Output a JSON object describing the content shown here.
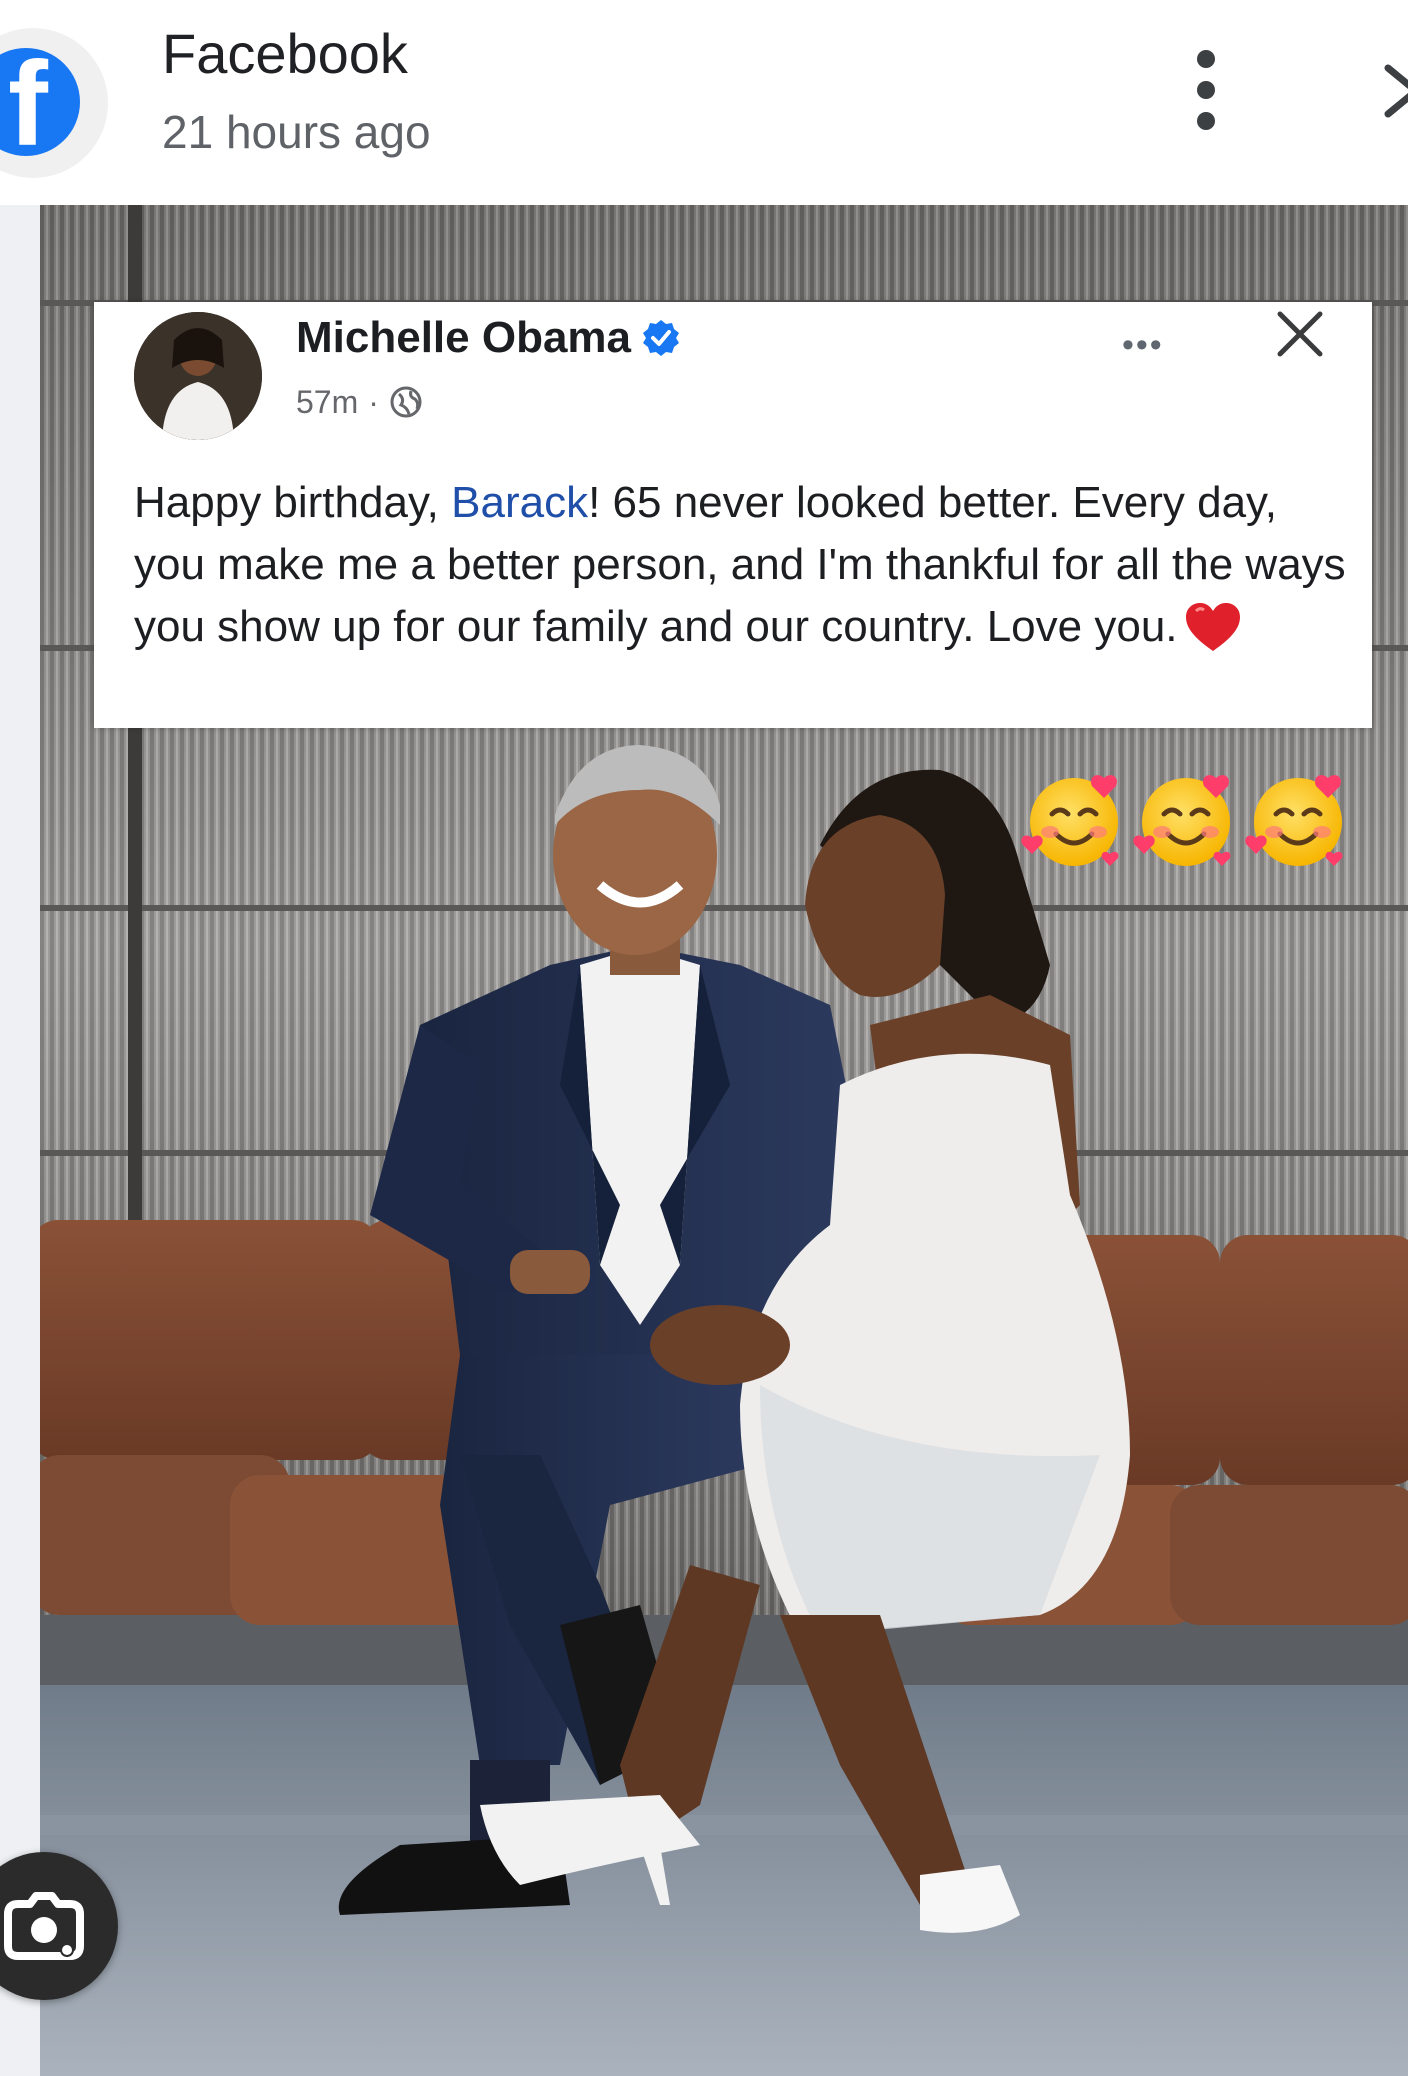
{
  "header": {
    "app_title": "Facebook",
    "post_time": "21 hours ago",
    "brand_color": "#1877f2",
    "icons": [
      "facebook-logo-icon",
      "more-vert-icon",
      "close-icon"
    ]
  },
  "embedded_post": {
    "author": "Michelle Obama",
    "verified": true,
    "time": "57m",
    "meta_separator": "·",
    "body_before_mention": "Happy birthday, ",
    "mention": "Barack",
    "body_after_mention": "! 65 never looked better. Every day, you make me a better person, and I'm thankful for all the ways you show up for our family and our country. Love you.",
    "more_label": "•••",
    "icons": [
      "globe-icon",
      "verified-badge-icon",
      "red-heart-icon",
      "close-icon",
      "more-horiz-icon"
    ]
  },
  "emoji_overlay": {
    "emoji_name": "smiling-face-with-hearts",
    "count": 3
  },
  "overlay_button": {
    "name": "screen-search-button",
    "icon": "lens-camera-icon"
  }
}
